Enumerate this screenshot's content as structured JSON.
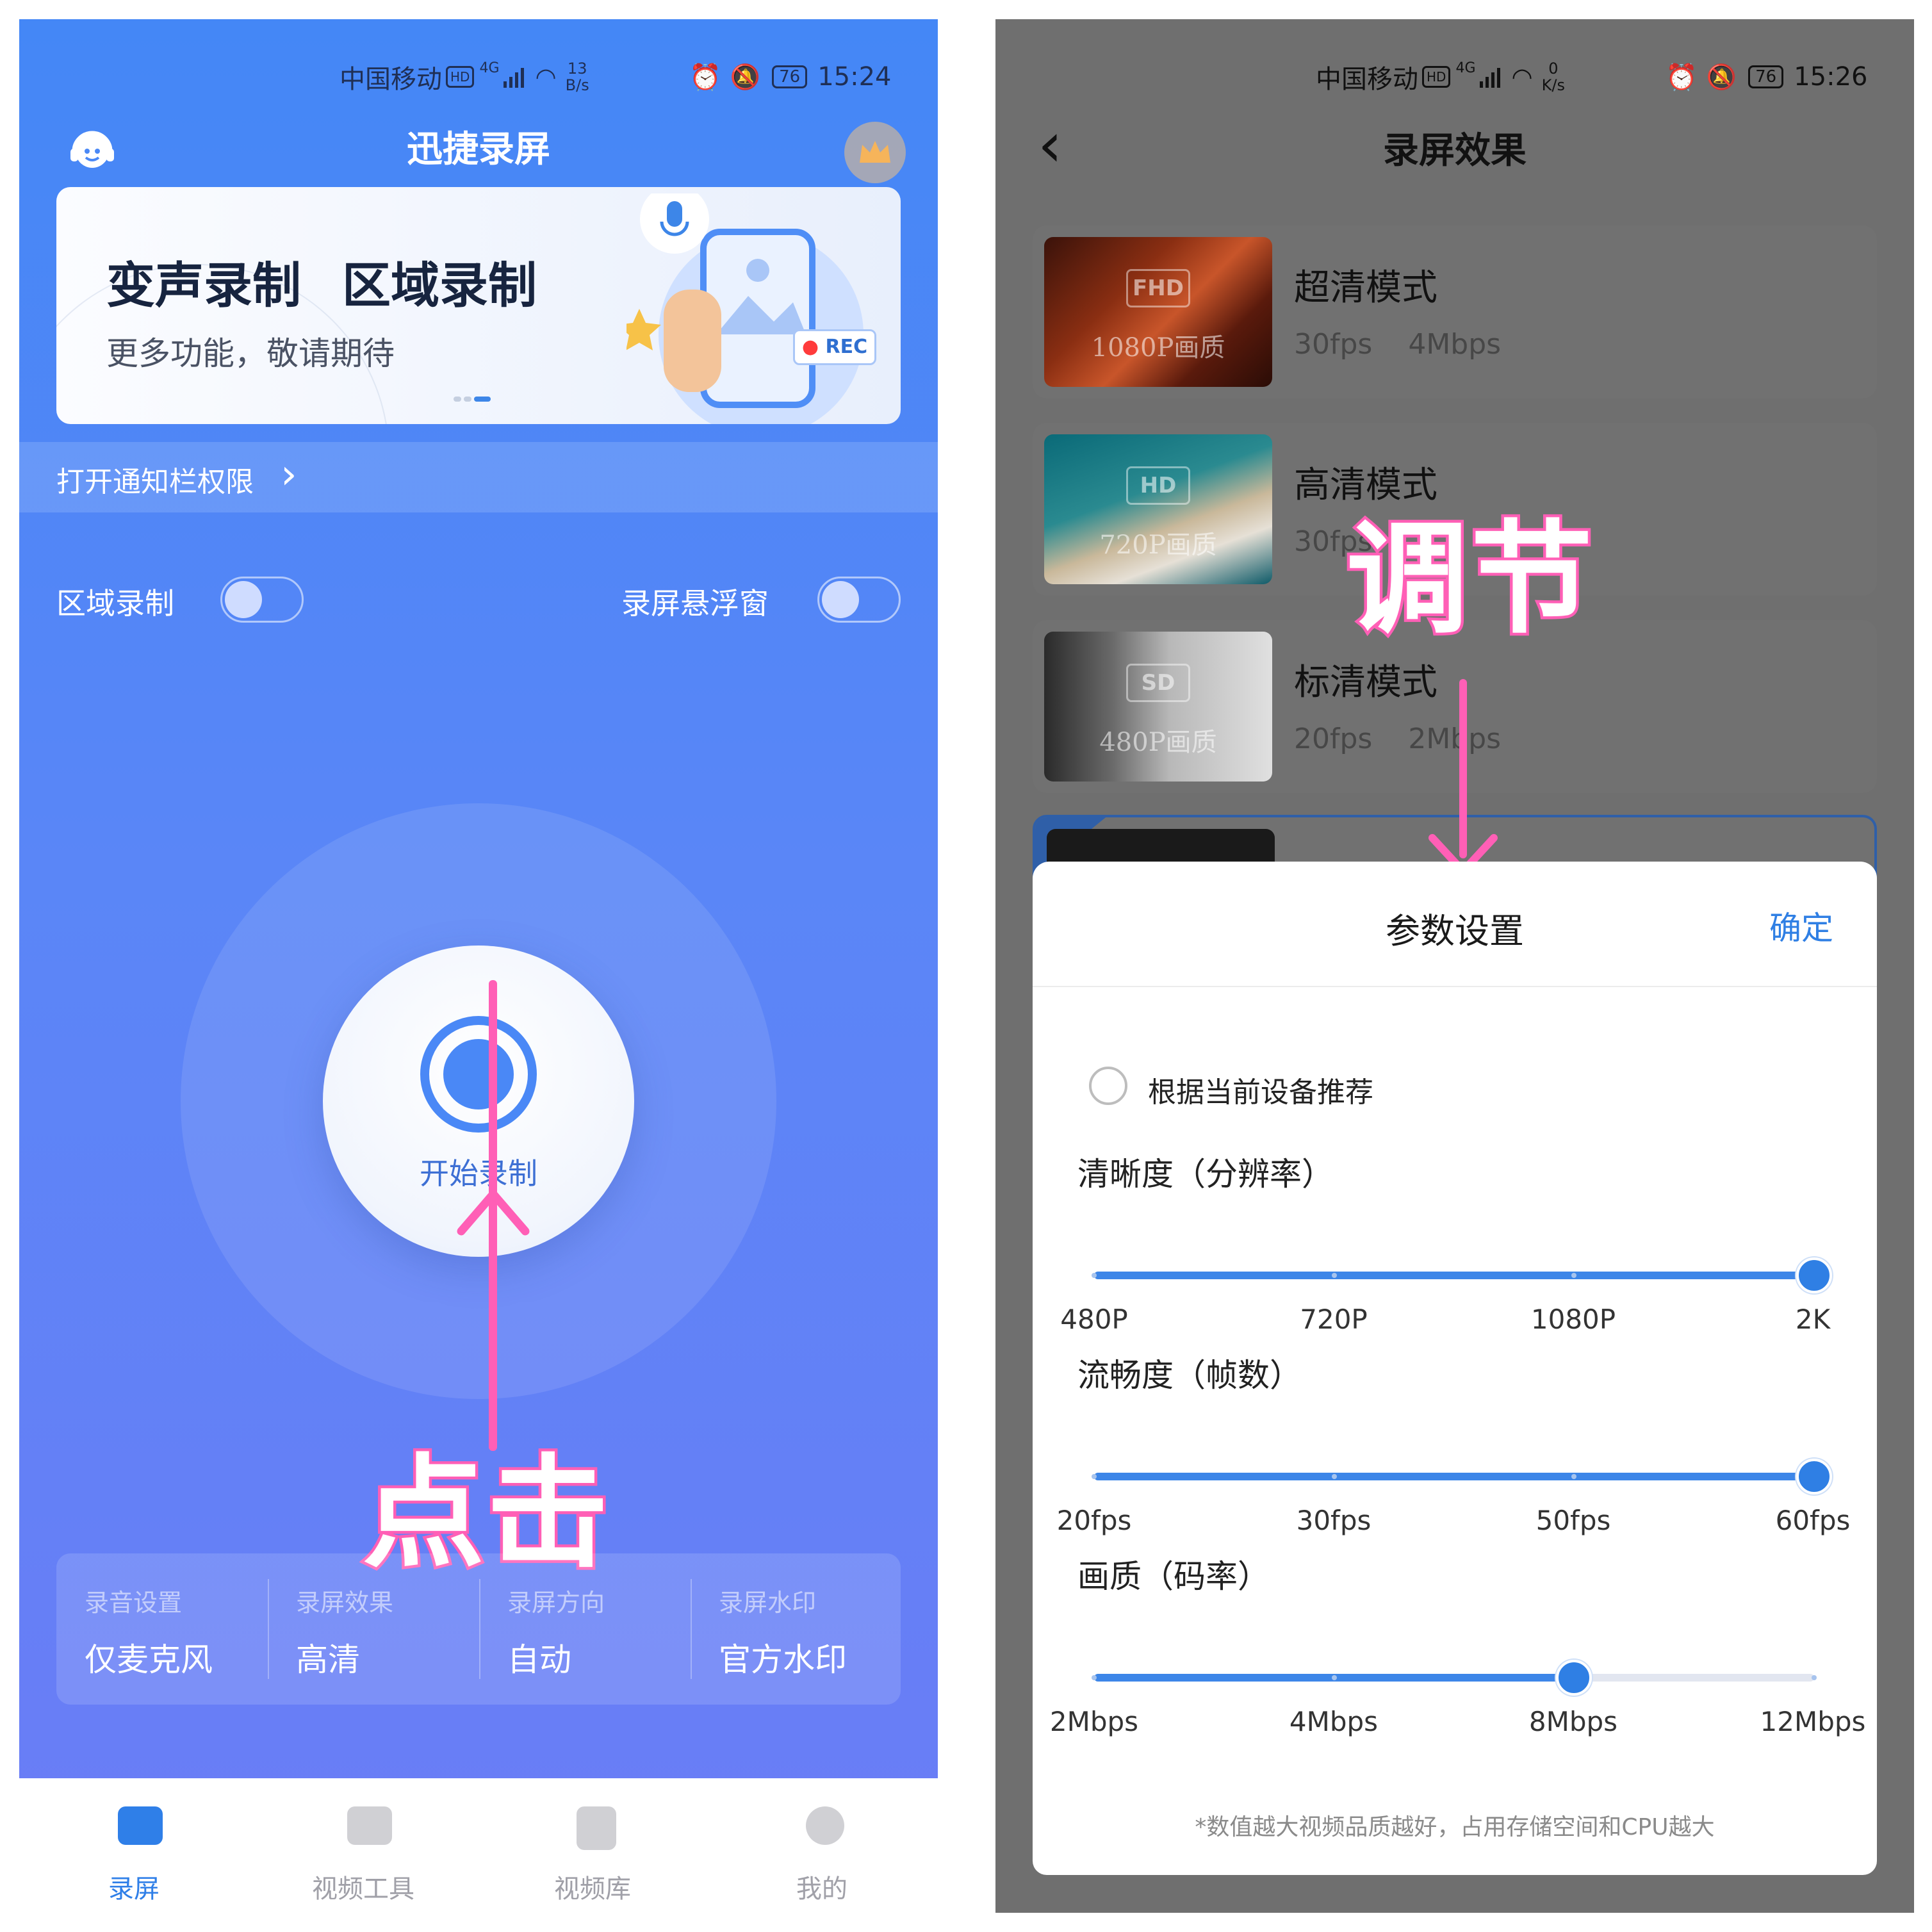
{
  "left": {
    "status": {
      "carrier": "中国移动",
      "hd": "HD",
      "net": "4G",
      "speed_top": "13",
      "speed_unit": "B/s",
      "battery": "76",
      "time": "15:24"
    },
    "header": {
      "title": "迅捷录屏"
    },
    "banner": {
      "title1": "变声录制",
      "title2": "区域录制",
      "subtitle": "更多功能，敬请期待",
      "rec_label": "REC"
    },
    "notice": {
      "label": "打开通知栏权限",
      "chevron": "›"
    },
    "toggles": [
      {
        "label": "区域录制",
        "on": false
      },
      {
        "label": "录屏悬浮窗",
        "on": false
      }
    ],
    "record_button": {
      "label": "开始录制"
    },
    "annotation": {
      "text": "点击",
      "color": "#ff5fb6"
    },
    "settings": [
      {
        "label": "录音设置",
        "value": "仅麦克风"
      },
      {
        "label": "录屏效果",
        "value": "高清"
      },
      {
        "label": "录屏方向",
        "value": "自动"
      },
      {
        "label": "录屏水印",
        "value": "官方水印"
      }
    ],
    "tabs": [
      {
        "label": "录屏",
        "icon": "video-camera-icon",
        "active": true
      },
      {
        "label": "视频工具",
        "icon": "toolbox-icon",
        "active": false
      },
      {
        "label": "视频库",
        "icon": "video-library-icon",
        "active": false
      },
      {
        "label": "我的",
        "icon": "profile-icon",
        "active": false
      }
    ],
    "colors": {
      "accent": "#4a88f6",
      "active_tab": "#2f7fe8"
    }
  },
  "right": {
    "status": {
      "carrier": "中国移动",
      "hd": "HD",
      "net": "4G",
      "speed_top": "0",
      "speed_unit": "K/s",
      "battery": "76",
      "time": "15:26"
    },
    "header": {
      "title": "录屏效果",
      "back": "‹"
    },
    "modes": [
      {
        "badge": "FHD",
        "quality": "1080P画质",
        "name": "超清模式",
        "fps": "30fps",
        "bitrate": "4Mbps"
      },
      {
        "badge": "HD",
        "quality": "720P画质",
        "name": "高清模式",
        "fps": "30fps",
        "bitrate": ""
      },
      {
        "badge": "SD",
        "quality": "480P画质",
        "name": "标清模式",
        "fps": "20fps",
        "bitrate": "2Mbps"
      }
    ],
    "annotation": {
      "text": "调节",
      "color": "#ff5fb6"
    },
    "sheet": {
      "title": "参数设置",
      "confirm": "确定",
      "recommend": "根据当前设备推荐",
      "sliders": [
        {
          "label": "清晰度（分辨率）",
          "ticks": [
            "480P",
            "720P",
            "1080P",
            "2K"
          ],
          "selected_index": 3
        },
        {
          "label": "流畅度（帧数）",
          "ticks": [
            "20fps",
            "30fps",
            "50fps",
            "60fps"
          ],
          "selected_index": 3
        },
        {
          "label": "画质（码率）",
          "ticks": [
            "2Mbps",
            "4Mbps",
            "8Mbps",
            "12Mbps"
          ],
          "selected_index": 2
        }
      ],
      "footnote": "*数值越大视频品质越好，占用存储空间和CPU越大"
    },
    "colors": {
      "confirm": "#2f7fe4",
      "slider": "#3d86e8"
    }
  }
}
